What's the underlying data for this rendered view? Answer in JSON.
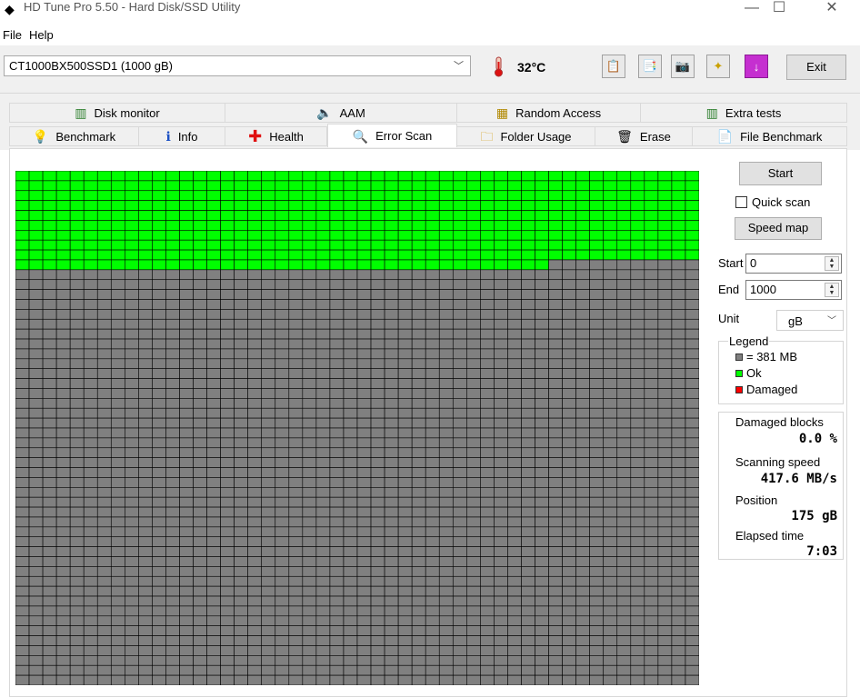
{
  "window": {
    "title": "HD Tune Pro 5.50 - Hard Disk/SSD Utility",
    "controls": {
      "minimize": "—",
      "maximize": "☐",
      "close": "✕"
    }
  },
  "menu": {
    "file": "File",
    "help": "Help"
  },
  "toolbar": {
    "drive": "CT1000BX500SSD1 (1000 gB)",
    "temperature": "32°C",
    "exit_label": "Exit",
    "icons": [
      "copy-text-icon",
      "copy-image-icon",
      "camera-icon",
      "save-icon",
      "download-icon"
    ]
  },
  "tabs_top": [
    {
      "label": "Disk monitor",
      "icon": "disk-monitor-icon"
    },
    {
      "label": "AAM",
      "icon": "speaker-icon"
    },
    {
      "label": "Random Access",
      "icon": "random-access-icon"
    },
    {
      "label": "Extra tests",
      "icon": "extra-tests-icon"
    }
  ],
  "tabs_bottom": [
    {
      "label": "Benchmark",
      "icon": "benchmark-icon"
    },
    {
      "label": "Info",
      "icon": "info-icon"
    },
    {
      "label": "Health",
      "icon": "health-icon"
    },
    {
      "label": "Error Scan",
      "icon": "magnifier-icon",
      "active": true
    },
    {
      "label": "Folder Usage",
      "icon": "folder-icon"
    },
    {
      "label": "Erase",
      "icon": "trash-icon"
    },
    {
      "label": "File Benchmark",
      "icon": "file-benchmark-icon"
    }
  ],
  "scan": {
    "grid_columns": 50,
    "grid_rows": 52,
    "ok_blocks_full_rows": 9,
    "ok_blocks_partial_row": 39,
    "ok_color": "#00ff00",
    "unscanned_color": "#808080",
    "damaged_color": "#ff0000"
  },
  "side": {
    "start_button": "Start",
    "quick_scan_label": "Quick scan",
    "quick_scan_checked": false,
    "speed_map_button": "Speed map",
    "start_label": "Start",
    "start_value": "0",
    "end_label": "End",
    "end_value": "1000",
    "unit_label": "Unit",
    "unit_value": "gB",
    "legend": {
      "title": "Legend",
      "block_size": "= 381 MB",
      "ok": "Ok",
      "damaged": "Damaged"
    },
    "stats": {
      "damaged_blocks_label": "Damaged blocks",
      "damaged_blocks_value": "0.0 %",
      "scanning_speed_label": "Scanning speed",
      "scanning_speed_value": "417.6 MB/s",
      "position_label": "Position",
      "position_value": "175 gB",
      "elapsed_label": "Elapsed time",
      "elapsed_value": "7:03"
    }
  }
}
